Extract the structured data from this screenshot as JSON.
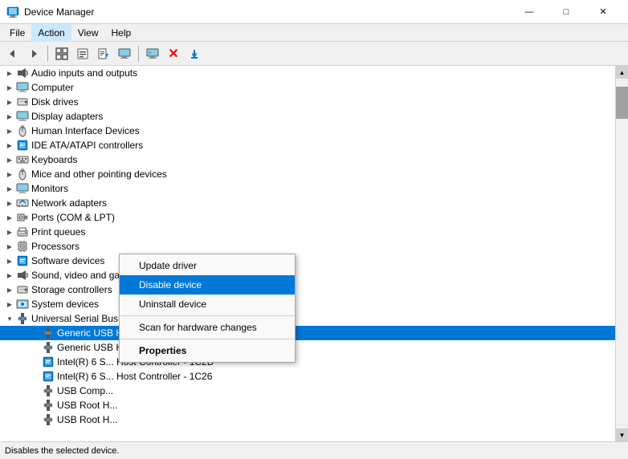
{
  "titleBar": {
    "icon": "💻",
    "title": "Device Manager",
    "minimizeLabel": "—",
    "maximizeLabel": "□",
    "closeLabel": "✕"
  },
  "menuBar": {
    "items": [
      "File",
      "Action",
      "View",
      "Help"
    ]
  },
  "toolbar": {
    "buttons": [
      {
        "name": "back-btn",
        "icon": "◀",
        "label": "Back"
      },
      {
        "name": "forward-btn",
        "icon": "▶",
        "label": "Forward"
      },
      {
        "name": "show-hidden-btn",
        "icon": "⊞",
        "label": "Show hidden"
      },
      {
        "name": "properties-btn",
        "icon": "📋",
        "label": "Properties"
      },
      {
        "name": "update-driver-btn",
        "icon": "📄",
        "label": "Update driver"
      },
      {
        "name": "scan-btn",
        "icon": "🖥",
        "label": "Scan"
      },
      {
        "name": "add-legacy-btn",
        "icon": "➕",
        "label": "Add legacy"
      },
      {
        "name": "remove-btn",
        "icon": "✕",
        "label": "Remove",
        "color": "red"
      },
      {
        "name": "download-btn",
        "icon": "⬇",
        "label": "Download"
      }
    ]
  },
  "tree": {
    "items": [
      {
        "id": "audio",
        "label": "Audio inputs and outputs",
        "icon": "🔊",
        "indent": 0,
        "expander": "closed"
      },
      {
        "id": "computer",
        "label": "Computer",
        "icon": "💻",
        "indent": 0,
        "expander": "closed"
      },
      {
        "id": "diskdrives",
        "label": "Disk drives",
        "icon": "💾",
        "indent": 0,
        "expander": "closed"
      },
      {
        "id": "displayadapters",
        "label": "Display adapters",
        "icon": "🖥",
        "indent": 0,
        "expander": "closed"
      },
      {
        "id": "hid",
        "label": "Human Interface Devices",
        "icon": "🖱",
        "indent": 0,
        "expander": "closed"
      },
      {
        "id": "ideata",
        "label": "IDE ATA/ATAPI controllers",
        "icon": "📦",
        "indent": 0,
        "expander": "closed"
      },
      {
        "id": "keyboards",
        "label": "Keyboards",
        "icon": "⌨",
        "indent": 0,
        "expander": "closed"
      },
      {
        "id": "mice",
        "label": "Mice and other pointing devices",
        "icon": "🖱",
        "indent": 0,
        "expander": "closed"
      },
      {
        "id": "monitors",
        "label": "Monitors",
        "icon": "🖥",
        "indent": 0,
        "expander": "closed"
      },
      {
        "id": "networkadapters",
        "label": "Network adapters",
        "icon": "🌐",
        "indent": 0,
        "expander": "closed"
      },
      {
        "id": "ports",
        "label": "Ports (COM & LPT)",
        "icon": "📦",
        "indent": 0,
        "expander": "closed"
      },
      {
        "id": "printqueues",
        "label": "Print queues",
        "icon": "🖨",
        "indent": 0,
        "expander": "closed"
      },
      {
        "id": "processors",
        "label": "Processors",
        "icon": "📦",
        "indent": 0,
        "expander": "closed"
      },
      {
        "id": "software",
        "label": "Software devices",
        "icon": "📦",
        "indent": 0,
        "expander": "closed"
      },
      {
        "id": "soundvideo",
        "label": "Sound, video and game controllers",
        "icon": "🔊",
        "indent": 0,
        "expander": "closed"
      },
      {
        "id": "storage",
        "label": "Storage controllers",
        "icon": "💾",
        "indent": 0,
        "expander": "closed"
      },
      {
        "id": "systemdevices",
        "label": "System devices",
        "icon": "💻",
        "indent": 0,
        "expander": "closed"
      },
      {
        "id": "usb",
        "label": "Universal Serial Bus controllers",
        "icon": "🔌",
        "indent": 0,
        "expander": "open"
      },
      {
        "id": "generic1",
        "label": "Generic USB Hub",
        "icon": "🔌",
        "indent": 1,
        "expander": "leaf",
        "selected": true
      },
      {
        "id": "generic2",
        "label": "Generic USB Hub",
        "icon": "🔌",
        "indent": 1,
        "expander": "leaf"
      },
      {
        "id": "intel1",
        "label": "Intel(R) 6 S... Host Controller - 1C2D",
        "icon": "📦",
        "indent": 1,
        "expander": "leaf"
      },
      {
        "id": "intel2",
        "label": "Intel(R) 6 S... Host Controller - 1C26",
        "icon": "📦",
        "indent": 1,
        "expander": "leaf"
      },
      {
        "id": "usbcomp",
        "label": "USB Comp...",
        "icon": "🔌",
        "indent": 1,
        "expander": "leaf"
      },
      {
        "id": "usbroot1",
        "label": "USB Root H...",
        "icon": "🔌",
        "indent": 1,
        "expander": "leaf"
      },
      {
        "id": "usbroot2",
        "label": "USB Root H...",
        "icon": "🔌",
        "indent": 1,
        "expander": "leaf"
      }
    ]
  },
  "contextMenu": {
    "items": [
      {
        "id": "update-driver",
        "label": "Update driver",
        "type": "normal"
      },
      {
        "id": "disable-device",
        "label": "Disable device",
        "type": "highlighted"
      },
      {
        "id": "uninstall-device",
        "label": "Uninstall device",
        "type": "normal"
      },
      {
        "id": "sep1",
        "type": "separator"
      },
      {
        "id": "scan-hardware",
        "label": "Scan for hardware changes",
        "type": "normal"
      },
      {
        "id": "sep2",
        "type": "separator"
      },
      {
        "id": "properties",
        "label": "Properties",
        "type": "bold"
      }
    ]
  },
  "statusBar": {
    "text": "Disables the selected device."
  }
}
